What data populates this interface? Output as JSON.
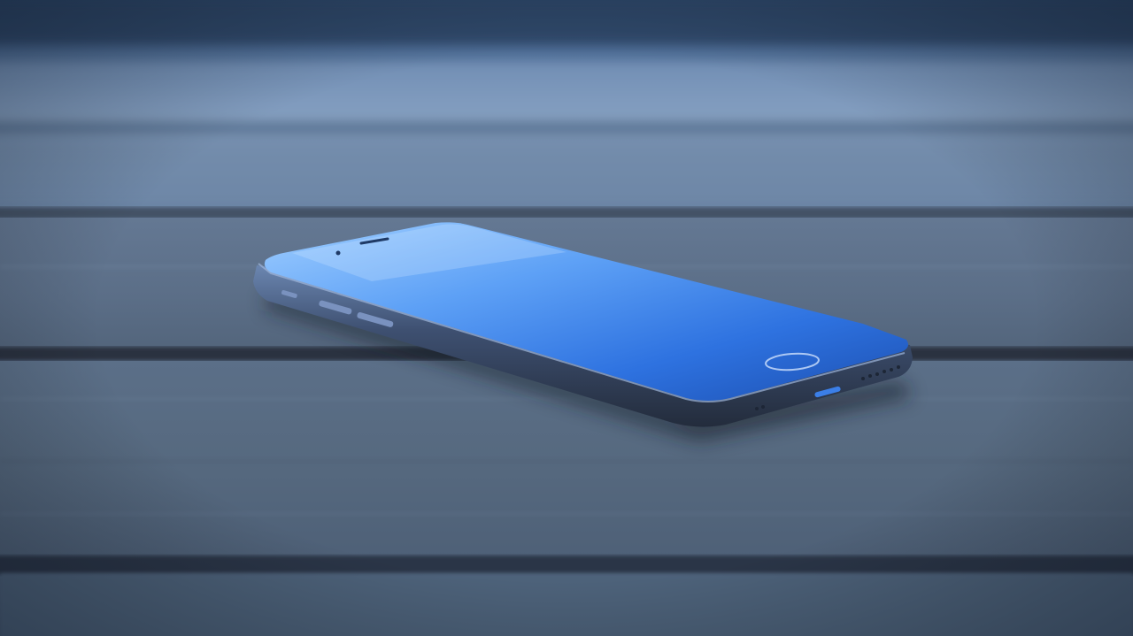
{
  "photo": {
    "subject": "smartphone",
    "surface": "wooden-plank-table",
    "palette": {
      "sky_top": "#2f4a6d",
      "plank_far": "#7f99b8",
      "plank_mid": "#5f7591",
      "plank_near": "#52657c",
      "plank_front": "#4a5d74",
      "gap_dark": "#2a3341",
      "phone_frame": "#3a4a63",
      "phone_frame_edge": "#6b86b0",
      "screen_light": "#8fc3ff",
      "screen_mid": "#3f86f0",
      "screen_dark": "#1c4fb0",
      "button_color": "#7a92bf"
    }
  }
}
